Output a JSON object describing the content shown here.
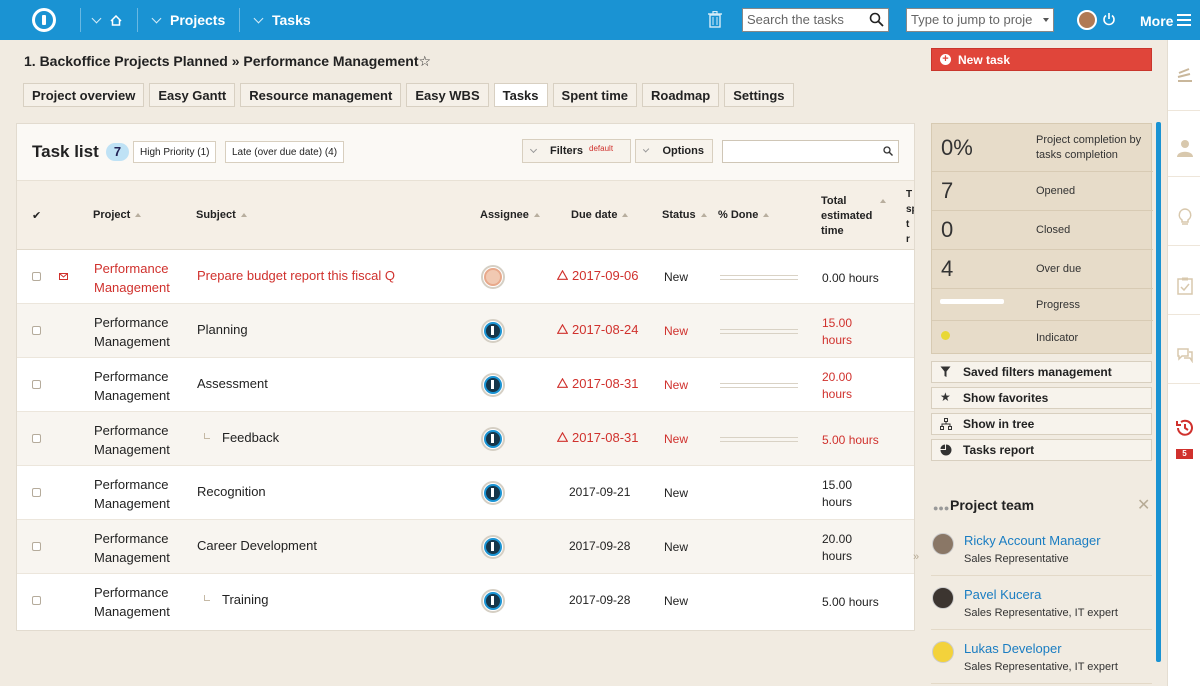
{
  "topbar": {
    "projects_label": "Projects",
    "tasks_label": "Tasks",
    "search_placeholder": "Search the tasks",
    "jump_placeholder": "Type to jump to proje",
    "more_label": "More",
    "accent_color": "#1a93d3"
  },
  "breadcrumb": "1. Backoffice Projects Planned » Performance Management",
  "tabs": [
    "Project overview",
    "Easy Gantt",
    "Resource management",
    "Easy WBS",
    "Tasks",
    "Spent time",
    "Roadmap",
    "Settings"
  ],
  "active_tab": "Tasks",
  "new_task_label": "New task",
  "task_list": {
    "title": "Task list",
    "count": "7",
    "pill_high_priority": "High Priority (1)",
    "pill_late": "Late (over due date) (4)",
    "filters_label": "Filters",
    "filters_default": "default",
    "options_label": "Options",
    "columns": {
      "project": "Project",
      "subject": "Subject",
      "assignee": "Assignee",
      "due_date": "Due date",
      "status": "Status",
      "done": "% Done",
      "estimated_1": "Total",
      "estimated_2": "estimated",
      "estimated_3": "time",
      "cut_1": "T",
      "cut_2": "sp",
      "cut_3": "t",
      "cut_4": "r"
    },
    "rows": [
      {
        "project_1": "Performance",
        "project_2": "Management",
        "subject": "Prepare budget report this fiscal Q",
        "due": "2017-09-06",
        "status": "New",
        "est_1": "0.00 hours",
        "est_2": ""
      },
      {
        "project_1": "Performance",
        "project_2": "Management",
        "subject": "Planning",
        "due": "2017-08-24",
        "status": "New",
        "est_1": "15.00",
        "est_2": "hours"
      },
      {
        "project_1": "Performance",
        "project_2": "Management",
        "subject": "Assessment",
        "due": "2017-08-31",
        "status": "New",
        "est_1": "20.00",
        "est_2": "hours"
      },
      {
        "project_1": "Performance",
        "project_2": "Management",
        "subject": "Feedback",
        "due": "2017-08-31",
        "status": "New",
        "est_1": "5.00 hours",
        "est_2": ""
      },
      {
        "project_1": "Performance",
        "project_2": "Management",
        "subject": "Recognition",
        "due": "2017-09-21",
        "status": "New",
        "est_1": "15.00",
        "est_2": "hours"
      },
      {
        "project_1": "Performance",
        "project_2": "Management",
        "subject": "Career Development",
        "due": "2017-09-28",
        "status": "New",
        "est_1": "20.00",
        "est_2": "hours"
      },
      {
        "project_1": "Performance",
        "project_2": "Management",
        "subject": "Training",
        "due": "2017-09-28",
        "status": "New",
        "est_1": "5.00 hours",
        "est_2": ""
      }
    ]
  },
  "stats": {
    "completion_value": "0%",
    "completion_label_1": "Project completion by",
    "completion_label_2": "tasks completion",
    "opened_value": "7",
    "opened_label": "Opened",
    "closed_value": "0",
    "closed_label": "Closed",
    "overdue_value": "4",
    "overdue_label": "Over due",
    "progress_label": "Progress",
    "indicator_label": "Indicator",
    "indicator_color": "#e8d836"
  },
  "side_buttons": {
    "saved_filters": "Saved filters management",
    "favorites": "Show favorites",
    "tree": "Show in tree",
    "report": "Tasks report"
  },
  "team": {
    "title": "Project team",
    "members": [
      {
        "name": "Ricky Account Manager",
        "role": "Sales Representative"
      },
      {
        "name": "Pavel Kucera",
        "role": "Sales Representative, IT expert"
      },
      {
        "name": "Lukas Developer",
        "role": "Sales Representative, IT expert"
      }
    ]
  },
  "rail_badge": "5"
}
